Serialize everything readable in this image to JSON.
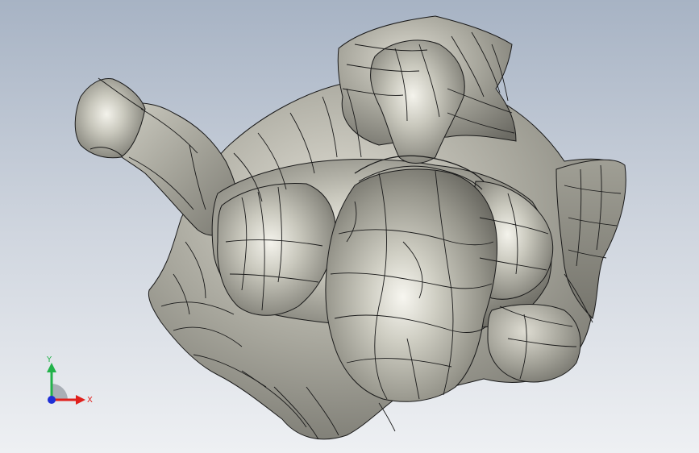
{
  "viewport": {
    "background_top": "#a7b3c4",
    "background_bottom": "#eef0f3"
  },
  "model": {
    "surface_color": "#b3b2a8",
    "edge_color": "#1a1a1a"
  },
  "triad": {
    "x_label": "X",
    "y_label": "Y",
    "x_color": "#e0201c",
    "y_color": "#22b24a",
    "z_color": "#1f2fd6"
  }
}
